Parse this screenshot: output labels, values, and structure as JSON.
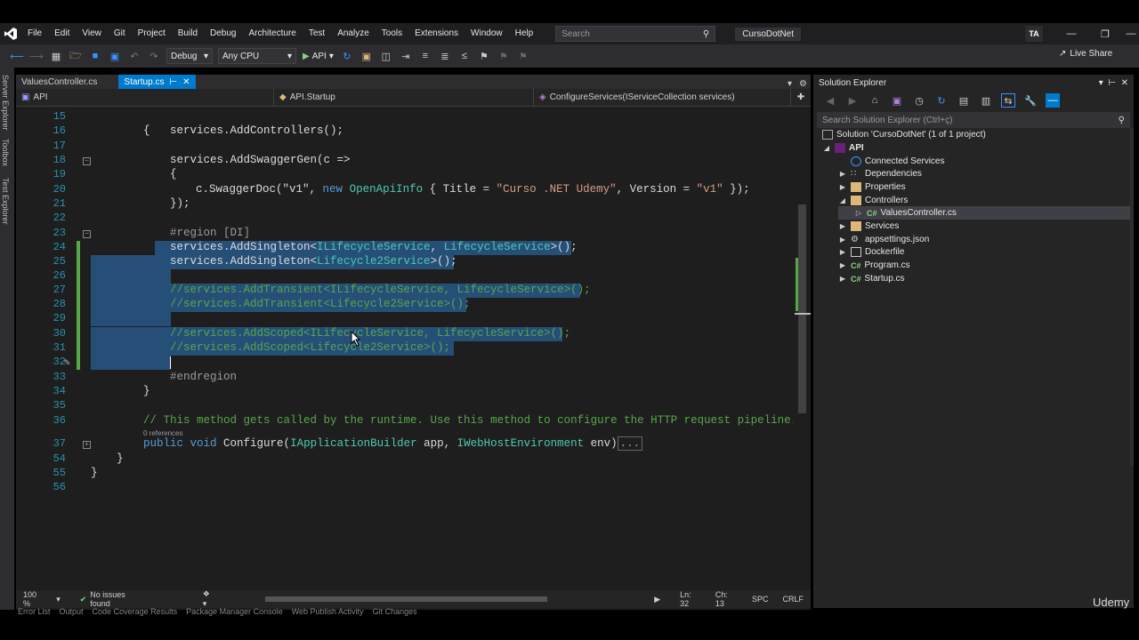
{
  "menubar": {
    "items": [
      "File",
      "Edit",
      "View",
      "Git",
      "Project",
      "Build",
      "Debug",
      "Architecture",
      "Test",
      "Analyze",
      "Tools",
      "Extensions",
      "Window",
      "Help"
    ],
    "search_placeholder": "Search",
    "solution_name": "CursoDotNet",
    "user_initials": "TA"
  },
  "toolbar": {
    "configuration": "Debug",
    "platform": "Any CPU",
    "run_target": "API",
    "live_share": "Live Share"
  },
  "left_strip": [
    "Server Explorer",
    "Toolbox",
    "Test Explorer"
  ],
  "tabs": [
    {
      "label": "ValuesController.cs",
      "active": false
    },
    {
      "label": "Startup.cs",
      "active": true
    }
  ],
  "navbar": {
    "project": "API",
    "class": "API.Startup",
    "member": "ConfigureServices(IServiceCollection services)"
  },
  "code": {
    "line_numbers": [
      "15",
      "16",
      "17",
      "18",
      "19",
      "20",
      "21",
      "22",
      "23",
      "24",
      "25",
      "26",
      "27",
      "28",
      "29",
      "30",
      "31",
      "32",
      "33",
      "34",
      "35",
      "36",
      "37",
      "54",
      "55",
      "56"
    ],
    "lines": {
      "l16": "{",
      "l17": "services.AddControllers();",
      "l19_a": "services.AddSwaggerGen(c =>",
      "l20": "{",
      "l21_a": "c.SwaggerDoc(\"v1\", ",
      "l21_new": "new",
      "l21_type": "OpenApiInfo",
      "l21_b": " { Title = ",
      "l21_s1": "\"Curso .NET Udemy\"",
      "l21_c": ", Version = ",
      "l21_s2": "\"v1\"",
      "l21_d": " });",
      "l22": "});",
      "l24": "#region [DI]",
      "l25_a": "services.AddSingleton<",
      "l25_t1": "ILifecycleService",
      "l25_t2": "LifecycleService",
      "l25_b": ">();",
      "l26_a": "services.AddSingleton<",
      "l26_t": "Lifecycle2Service",
      "l26_b": ">();",
      "l28": "//services.AddTransient<ILifecycleService, LifecycleService>();",
      "l29": "//services.AddTransient<Lifecycle2Service>();",
      "l31": "//services.AddScoped<ILifecycleService, LifecycleService>();",
      "l32": "//services.AddScoped<Lifecycle2Service>();",
      "l34": "#endregion",
      "l35": "}",
      "l37": "// This method gets called by the runtime. Use this method to configure the HTTP request pipeline.",
      "refs": "0 references",
      "l38_pub": "public",
      "l38_void": "void",
      "l38_a": " Configure(",
      "l38_t1": "IApplicationBuilder",
      "l38_b": " app, ",
      "l38_t2": "IWebHostEnvironment",
      "l38_c": " env)",
      "l38_dots": "...",
      "l54": "}",
      "l55": "}"
    }
  },
  "status": {
    "zoom": "100 %",
    "issues": "No issues found",
    "line": "Ln: 32",
    "col": "Ch: 13",
    "spc": "SPC",
    "crlf": "CRLF"
  },
  "bottom_tabs": [
    "Error List",
    "Output",
    "Code Coverage Results",
    "Package Manager Console",
    "Web Publish Activity",
    "Git Changes"
  ],
  "watermark": "Udemy",
  "solution_explorer": {
    "title": "Solution Explorer",
    "search_placeholder": "Search Solution Explorer (Ctrl+ç)",
    "solution": "Solution 'CursoDotNet' (1 of 1 project)",
    "project": "API",
    "items": [
      "Connected Services",
      "Dependencies",
      "Properties",
      "Controllers",
      "ValuesController.cs",
      "Services",
      "appsettings.json",
      "Dockerfile",
      "Program.cs",
      "Startup.cs"
    ]
  },
  "colors": {
    "accent": "#007acc",
    "selection": "#264f78",
    "keyword": "#569cd6",
    "type": "#4ec9b0",
    "string": "#d69d85",
    "comment": "#57a64a"
  }
}
